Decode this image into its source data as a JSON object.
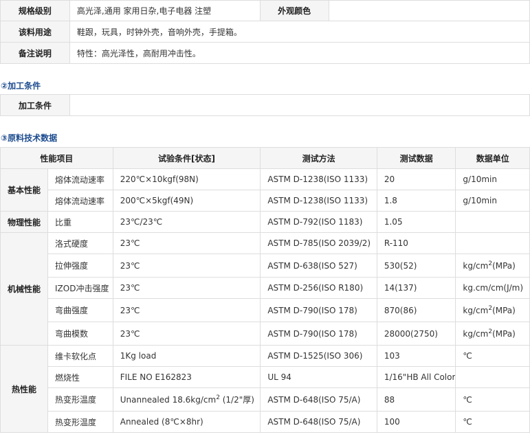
{
  "info_table": {
    "rows": [
      {
        "label": "规格级别",
        "value": "高光泽,通用 家用日杂,电子电器 注塑",
        "label2": "外观颜色",
        "value2": ""
      },
      {
        "label": "该料用途",
        "value": "鞋跟，玩具，时钟外壳，音响外壳，手提箱。"
      },
      {
        "label": "备注说明",
        "value": "特性：高光泽性，高耐用冲击性。"
      }
    ]
  },
  "processing": {
    "title": "②加工条件",
    "label": "加工条件",
    "value": ""
  },
  "tech": {
    "title": "③原料技术数据",
    "headers": [
      "性能项目",
      "试验条件[状态]",
      "测试方法",
      "测试数据",
      "数据单位"
    ],
    "groups": [
      "基本性能",
      "物理性能",
      "机械性能",
      "热性能"
    ],
    "rows": [
      {
        "item": "熔体流动速率",
        "cond": "220℃×10kgf(98N)",
        "method": "ASTM D-1238(ISO 1133)",
        "data": "20",
        "unit": "g/10min"
      },
      {
        "item": "熔体流动速率",
        "cond": "200℃×5kgf(49N)",
        "method": "ASTM D-1238(ISO 1133)",
        "data": "1.8",
        "unit": "g/10min"
      },
      {
        "item": "比重",
        "cond": "23℃/23℃",
        "method": "ASTM D-792(ISO 1183)",
        "data": "1.05",
        "unit": ""
      },
      {
        "item": "洛式硬度",
        "cond": "23℃",
        "method": "ASTM D-785(ISO 2039/2)",
        "data": "R-110",
        "unit": ""
      },
      {
        "item": "拉伸强度",
        "cond": "23℃",
        "method": "ASTM D-638(ISO 527)",
        "data": "530(52)",
        "unit_pre": "kg/cm",
        "unit_sup": "2",
        "unit_post": "(MPa)"
      },
      {
        "item": "IZOD冲击强度",
        "cond": "23℃",
        "method": "ASTM D-256(ISO R180)",
        "data": "14(137)",
        "unit": "kg.cm/cm(J/m)"
      },
      {
        "item": "弯曲强度",
        "cond": "23℃",
        "method": "ASTM D-790(ISO 178)",
        "data": "870(86)",
        "unit_pre": "kg/cm",
        "unit_sup": "2",
        "unit_post": "(MPa)"
      },
      {
        "item": "弯曲模数",
        "cond": "23℃",
        "method": "ASTM D-790(ISO 178)",
        "data": "28000(2750)",
        "unit_pre": "kg/cm",
        "unit_sup": "2",
        "unit_post": "(MPa)"
      },
      {
        "item": "维卡软化点",
        "cond": "1Kg load",
        "method": "ASTM D-1525(ISO 306)",
        "data": "103",
        "unit": "℃"
      },
      {
        "item": "燃烧性",
        "cond": "FILE NO E162823",
        "method": "UL 94",
        "data": "1/16\"HB All Color",
        "unit": ""
      },
      {
        "item": "热变形温度",
        "cond_pre": "Unannealed 18.6kg/cm",
        "cond_sup": "2",
        "cond_post": " (1/2\"厚)",
        "method": "ASTM D-648(ISO 75/A)",
        "data": "88",
        "unit": "℃"
      },
      {
        "item": "热变形温度",
        "cond": "Annealed (8℃×8hr)",
        "method": "ASTM D-648(ISO 75/A)",
        "data": "100",
        "unit": "℃"
      }
    ]
  }
}
